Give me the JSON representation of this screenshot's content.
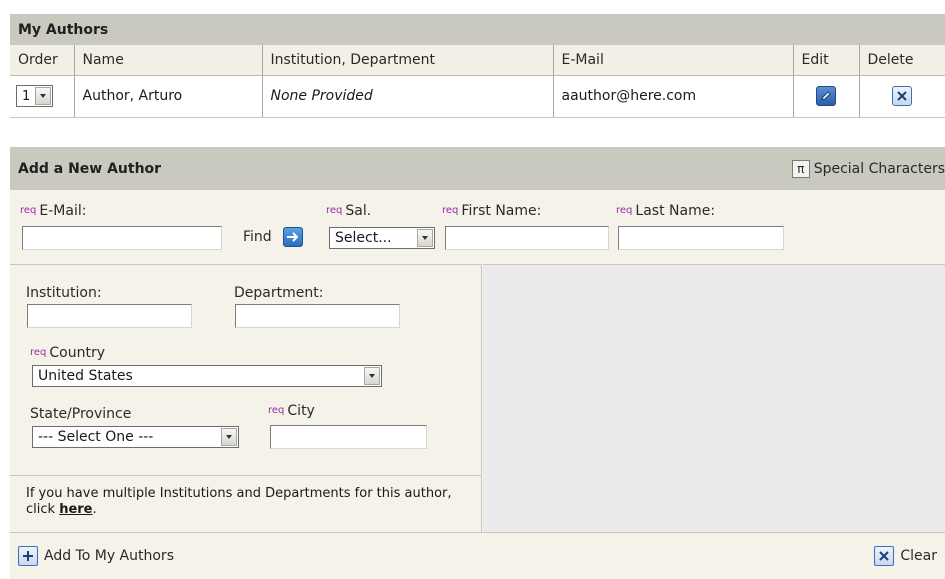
{
  "my_authors": {
    "title": "My Authors",
    "columns": [
      "Order",
      "Name",
      "Institution, Department",
      "E-Mail",
      "Edit",
      "Delete"
    ],
    "rows": [
      {
        "order": "1",
        "name": "Author, Arturo",
        "institution": "None Provided",
        "email": "aauthor@here.com"
      }
    ]
  },
  "add_author": {
    "title": "Add a New Author",
    "special_characters": "Special Characters",
    "req_marker": "req",
    "email_label": "E-Mail:",
    "find_label": "Find",
    "salutation_label": "Sal.",
    "salutation_value": "Select...",
    "first_name_label": "First Name:",
    "last_name_label": "Last Name:",
    "institution_label": "Institution:",
    "department_label": "Department:",
    "country_label": "Country",
    "country_value": "United States",
    "state_label": "State/Province",
    "state_value": "--- Select One ---",
    "city_label": "City",
    "multi_note_text": "If you have multiple Institutions and Departments for this author, click",
    "multi_note_link": "here",
    "multi_note_end": ".",
    "add_button": "Add To My Authors",
    "clear_button": "Clear"
  },
  "icons": {
    "edit": "edit-pencil-icon",
    "delete": "delete-x-icon",
    "special_chars": "pi-icon",
    "find": "arrow-right-icon",
    "add": "plus-icon",
    "clear": "x-icon"
  },
  "colors": {
    "title_bar": "#c9c9bf",
    "panel_bg": "#f4f2e9",
    "req": "#9a2aa8",
    "icon_blue": "#2a6fbd"
  }
}
